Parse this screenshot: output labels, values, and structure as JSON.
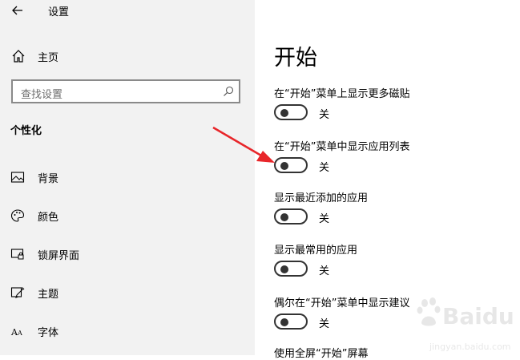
{
  "window": {
    "title": "设置"
  },
  "sidebar": {
    "home_label": "主页",
    "search_placeholder": "查找设置",
    "section_title": "个性化",
    "items": [
      {
        "label": "背景",
        "icon": "image-icon"
      },
      {
        "label": "颜色",
        "icon": "palette-icon"
      },
      {
        "label": "锁屏界面",
        "icon": "lock-screen-icon"
      },
      {
        "label": "主题",
        "icon": "theme-icon"
      },
      {
        "label": "字体",
        "icon": "font-icon"
      }
    ]
  },
  "main": {
    "title": "开始",
    "settings": [
      {
        "label": "在“开始”菜单上显示更多磁贴",
        "state": "关",
        "on": false
      },
      {
        "label": "在“开始”菜单中显示应用列表",
        "state": "关",
        "on": false
      },
      {
        "label": "显示最近添加的应用",
        "state": "关",
        "on": false
      },
      {
        "label": "显示最常用的应用",
        "state": "关",
        "on": false
      },
      {
        "label": "偶尔在“开始”菜单中显示建议",
        "state": "关",
        "on": false
      },
      {
        "label": "使用全屏“开始”屏幕",
        "state": "",
        "on": false
      }
    ]
  },
  "annotation": {
    "arrow_color": "#e8262a"
  },
  "watermark": {
    "text": "Baidu 经验",
    "subtext": "jingyan.baidu.com"
  }
}
